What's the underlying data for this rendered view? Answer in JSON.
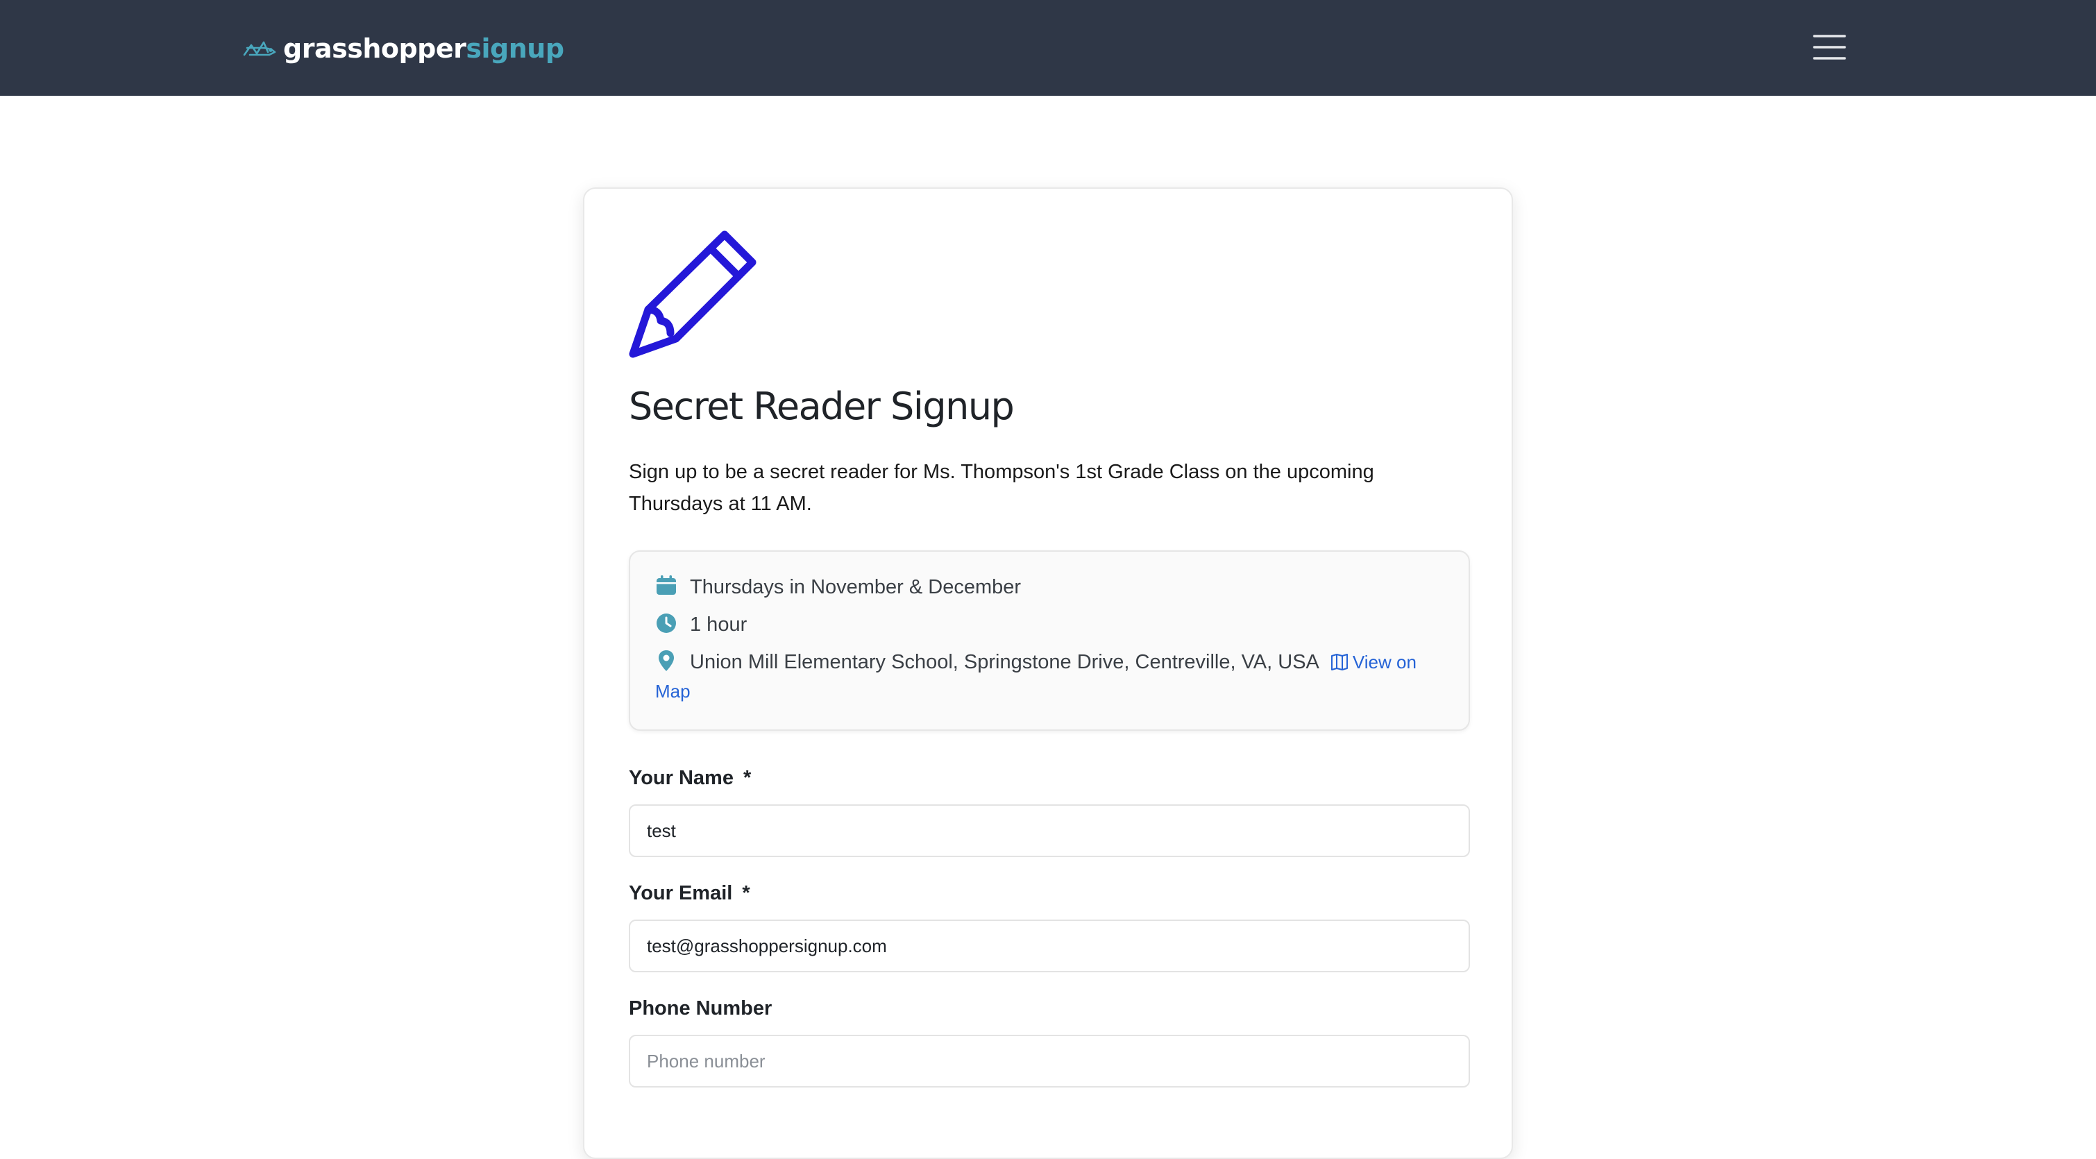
{
  "brand": {
    "name_part1": "grasshopper",
    "name_part2": "signup"
  },
  "colors": {
    "header_bg": "#2f3747",
    "brand_accent": "#49a7bd",
    "icon_accent": "#4a9fb5",
    "pencil": "#2418d8",
    "link": "#2563d6"
  },
  "header": {
    "menu_icon": "hamburger-menu-icon"
  },
  "signup": {
    "icon": "pencil-icon",
    "title": "Secret Reader Signup",
    "description": "Sign up to be a secret reader for Ms. Thompson's 1st Grade Class on the upcoming Thursdays at 11 AM.",
    "details": {
      "date": "Thursdays in November & December",
      "duration": "1 hour",
      "location": "Union Mill Elementary School, Springstone Drive, Centreville, VA, USA",
      "map_link": "View on Map"
    }
  },
  "form": {
    "name": {
      "label": "Your Name",
      "required_marker": "*",
      "value": "test"
    },
    "email": {
      "label": "Your Email",
      "required_marker": "*",
      "value": "test@grasshoppersignup.com"
    },
    "phone": {
      "label": "Phone Number",
      "placeholder": "Phone number"
    }
  }
}
